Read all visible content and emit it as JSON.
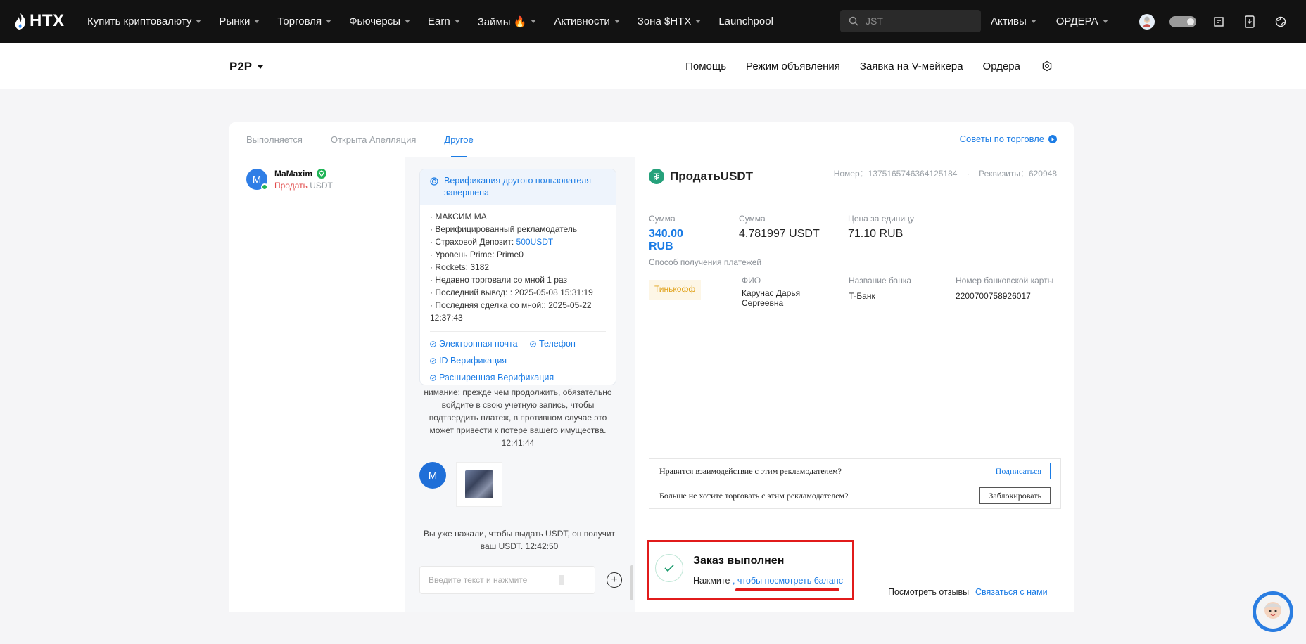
{
  "brand": {
    "logo_text": "HTX"
  },
  "topnav": {
    "items": [
      {
        "label": "Купить криптовалюту",
        "has_caret": true
      },
      {
        "label": "Рынки",
        "has_caret": true
      },
      {
        "label": "Торговля",
        "has_caret": true
      },
      {
        "label": "Фьючерсы",
        "has_caret": true
      },
      {
        "label": "Earn",
        "has_caret": true
      },
      {
        "label": "Займы 🔥",
        "has_caret": true
      },
      {
        "label": "Активности",
        "has_caret": true
      },
      {
        "label": "Зона $HTX",
        "has_caret": true
      },
      {
        "label": "Launchpool",
        "has_caret": false
      }
    ],
    "search_placeholder": "JST",
    "assets_label": "Активы",
    "orders_label": "ОРДЕРА",
    "icons": [
      "user-avatar-icon",
      "toggle-icon",
      "orders-icon",
      "download-icon",
      "globe-icon"
    ]
  },
  "subheader": {
    "title": "P2P",
    "links": [
      "Помощь",
      "Режим объявления",
      "Заявка на V-мейкера",
      "Ордера"
    ]
  },
  "tabs": {
    "items": [
      "Выполняется",
      "Открыта Апелляция",
      "Другое"
    ],
    "active": 2,
    "tips_label": "Советы по торговле"
  },
  "contact": {
    "initial": "M",
    "name": "MaMaxim",
    "side": "Продать",
    "asset": "USDT"
  },
  "chat": {
    "verify_title": "Верификация другого пользователя завершена",
    "details": [
      "· МАКСИМ МА",
      "· Верифицированный рекламодатель",
      "· Страховой Депозит: ",
      "· Уровень Prime: Prime0",
      "· Rockets: 3182",
      "· Недавно торговали со мной 1 раз",
      "· Последний вывод: : 2025-05-08 15:31:19",
      "· Последняя сделка со мной:: 2025-05-22 12:37:43"
    ],
    "deposit_value": "500USDT",
    "badges": [
      "Электронная почта",
      "Телефон",
      "ID Верификация",
      "Расширенная Верификация"
    ],
    "system_message": "нимание: прежде чем продолжить, обязательно войдите в свою учетную запись, чтобы подтвердить платеж, в противном случае это может привести к потере вашего имущества. 12:41:44",
    "image_sender_initial": "M",
    "release_message": "Вы уже нажали, чтобы выдать USDT, он получит ваш USDT. 12:42:50",
    "input_placeholder": "Введите текст и нажмите"
  },
  "order": {
    "title": "ПродатьUSDT",
    "number_label": "Номер：",
    "number": "1375165746364125184",
    "requisites_label": "Реквизиты：",
    "requisites": "620948",
    "amount_label": "Сумма",
    "amount_rub": "340.00 RUB",
    "amount_label_2": "Сумма",
    "amount_usdt": "4.781997 USDT",
    "price_label": "Цена за единицу",
    "price": "71.10 RUB",
    "payment_method_label": "Способ получения платежей",
    "bank_tag": "Тинькофф",
    "fio_label": "ФИО",
    "fio_value": "Карунас Дарья Сергеевна",
    "bank_name_label": "Название банка",
    "bank_name_value": "Т-Банк",
    "card_label": "Номер банковской карты",
    "card_value": "2200700758926017"
  },
  "feedback": {
    "like_question": "Нравится взаимодействие с этим рекламодателем?",
    "subscribe_label": "Подписаться",
    "block_question": "Больше не хотите торговать с этим рекламодателем?",
    "block_label": "Заблокировать"
  },
  "bottom": {
    "reviews_label": "Посмотреть отзывы",
    "contact_label": "Связаться с нами"
  },
  "completed": {
    "title": "Заказ выполнен",
    "prefix": "Нажмите",
    "link": ", чтобы посмотреть баланс"
  },
  "colors": {
    "accent": "#1b7ce5",
    "sell": "#e14a4a",
    "highlight": "#e11b1b",
    "tether": "#26a17b"
  }
}
